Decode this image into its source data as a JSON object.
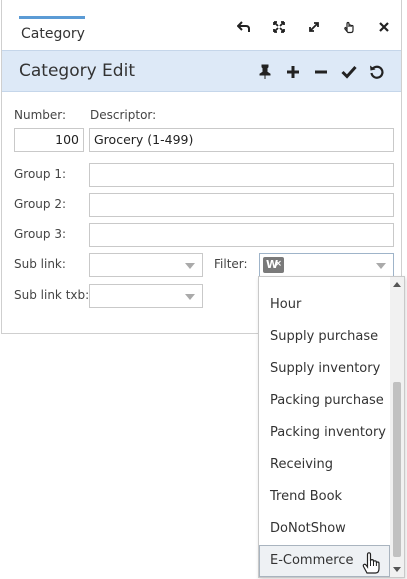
{
  "window": {
    "tab_label": "Category",
    "header_title": "Category Edit"
  },
  "form": {
    "number_label": "Number:",
    "descriptor_label": "Descriptor:",
    "number_value": "100",
    "descriptor_value": "Grocery (1-499)",
    "group1_label": "Group 1:",
    "group2_label": "Group 2:",
    "group3_label": "Group 3:",
    "group1_value": "",
    "group2_value": "",
    "group3_value": "",
    "sublink_label": "Sub link:",
    "filter_label": "Filter:",
    "sublink_txb_label": "Sub link txb:",
    "filter_badge": "W",
    "filter_badge_clear": "×"
  },
  "dropdown": {
    "items": [
      {
        "label": "Hour"
      },
      {
        "label": "Supply purchase"
      },
      {
        "label": "Supply inventory"
      },
      {
        "label": "Packing purchase"
      },
      {
        "label": "Packing inventory"
      },
      {
        "label": "Receiving"
      },
      {
        "label": "Trend Book"
      },
      {
        "label": "DoNotShow"
      },
      {
        "label": "E-Commerce"
      }
    ],
    "highlighted": "E-Commerce"
  },
  "colors": {
    "accent": "#5b9bd5",
    "header_bg": "#dde9f7",
    "badge_bg": "#7a7a7a"
  }
}
